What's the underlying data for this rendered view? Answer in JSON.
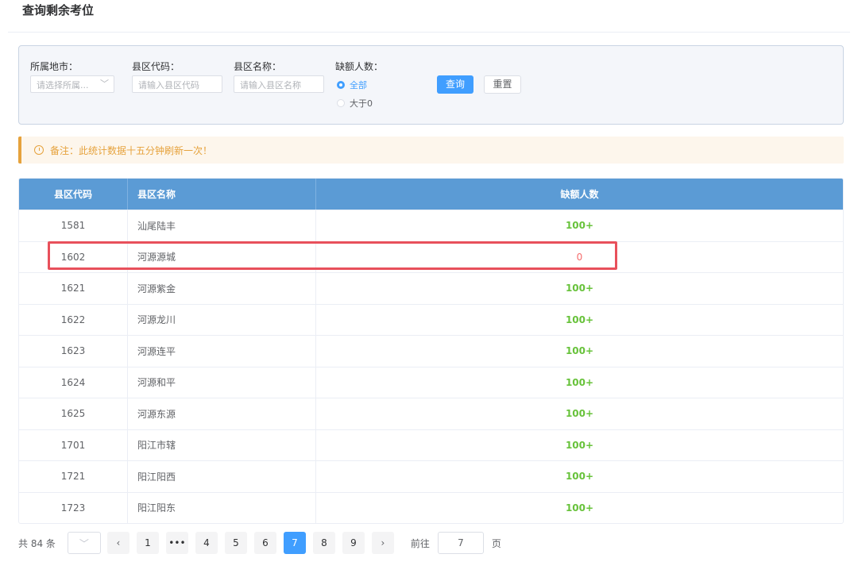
{
  "page": {
    "title": "查询剩余考位"
  },
  "filters": {
    "city_label": "所属地市：",
    "city_placeholder": "请选择所属...",
    "county_code_label": "县区代码：",
    "county_code_placeholder": "请输入县区代码",
    "county_name_label": "县区名称：",
    "county_name_placeholder": "请输入县区名称",
    "shortage_label": "缺额人数：",
    "radio_all": "全部",
    "radio_gt0": "大于0",
    "query_button": "查询",
    "reset_button": "重置"
  },
  "notice": {
    "text": "备注：此统计数据十五分钟刷新一次！"
  },
  "table": {
    "headers": [
      "县区代码",
      "县区名称",
      "缺额人数"
    ],
    "rows": [
      {
        "code": "1581",
        "name": "汕尾陆丰",
        "value": "100+"
      },
      {
        "code": "1602",
        "name": "河源源城",
        "value": "0"
      },
      {
        "code": "1621",
        "name": "河源紫金",
        "value": "100+"
      },
      {
        "code": "1622",
        "name": "河源龙川",
        "value": "100+"
      },
      {
        "code": "1623",
        "name": "河源连平",
        "value": "100+"
      },
      {
        "code": "1624",
        "name": "河源和平",
        "value": "100+"
      },
      {
        "code": "1625",
        "name": "河源东源",
        "value": "100+"
      },
      {
        "code": "1701",
        "name": "阳江市辖",
        "value": "100+"
      },
      {
        "code": "1721",
        "name": "阳江阳西",
        "value": "100+"
      },
      {
        "code": "1723",
        "name": "阳江阳东",
        "value": "100+"
      }
    ]
  },
  "pagination": {
    "total": "共 84 条",
    "pages": [
      "1",
      "•••",
      "4",
      "5",
      "6",
      "7",
      "8",
      "9"
    ],
    "current": "7",
    "goto_label": "前往",
    "goto_value": "7",
    "page_suffix": "页"
  },
  "colors": {
    "primary": "#409eff",
    "header": "#5b9bd5",
    "green": "#67c23a",
    "red": "#f56c6c",
    "warning": "#e6a23c"
  }
}
